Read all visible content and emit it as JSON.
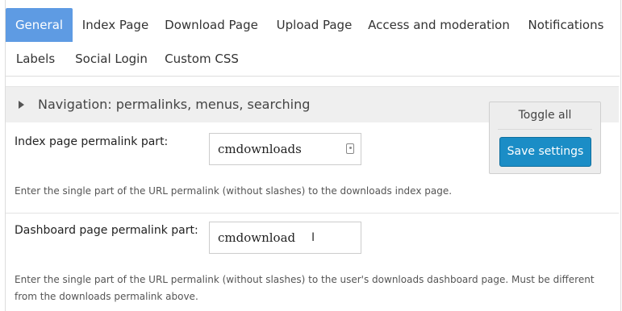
{
  "tabs": {
    "row1": [
      "General",
      "Index Page",
      "Download Page",
      "Upload Page",
      "Access and moderation",
      "Notifications"
    ],
    "row2": [
      "Labels",
      "Social Login",
      "Custom CSS"
    ],
    "active": "General"
  },
  "section": {
    "title": "Navigation: permalinks, menus, searching"
  },
  "panel": {
    "toggle_all": "Toggle all",
    "save_label": "Save settings"
  },
  "fields": [
    {
      "label": "Index page permalink part:",
      "value": "cmdownloads",
      "help": "Enter the single part of the URL permalink (without slashes) to the downloads index page."
    },
    {
      "label": "Dashboard page permalink part:",
      "value": "cmdownload",
      "help": "Enter the single part of the URL permalink (without slashes) to the user's downloads dashboard page. Must be different from the downloads permalink above."
    }
  ],
  "colors": {
    "active_tab": "#5e9be3",
    "save_button": "#1b8dc6",
    "section_bg": "#efefef"
  }
}
